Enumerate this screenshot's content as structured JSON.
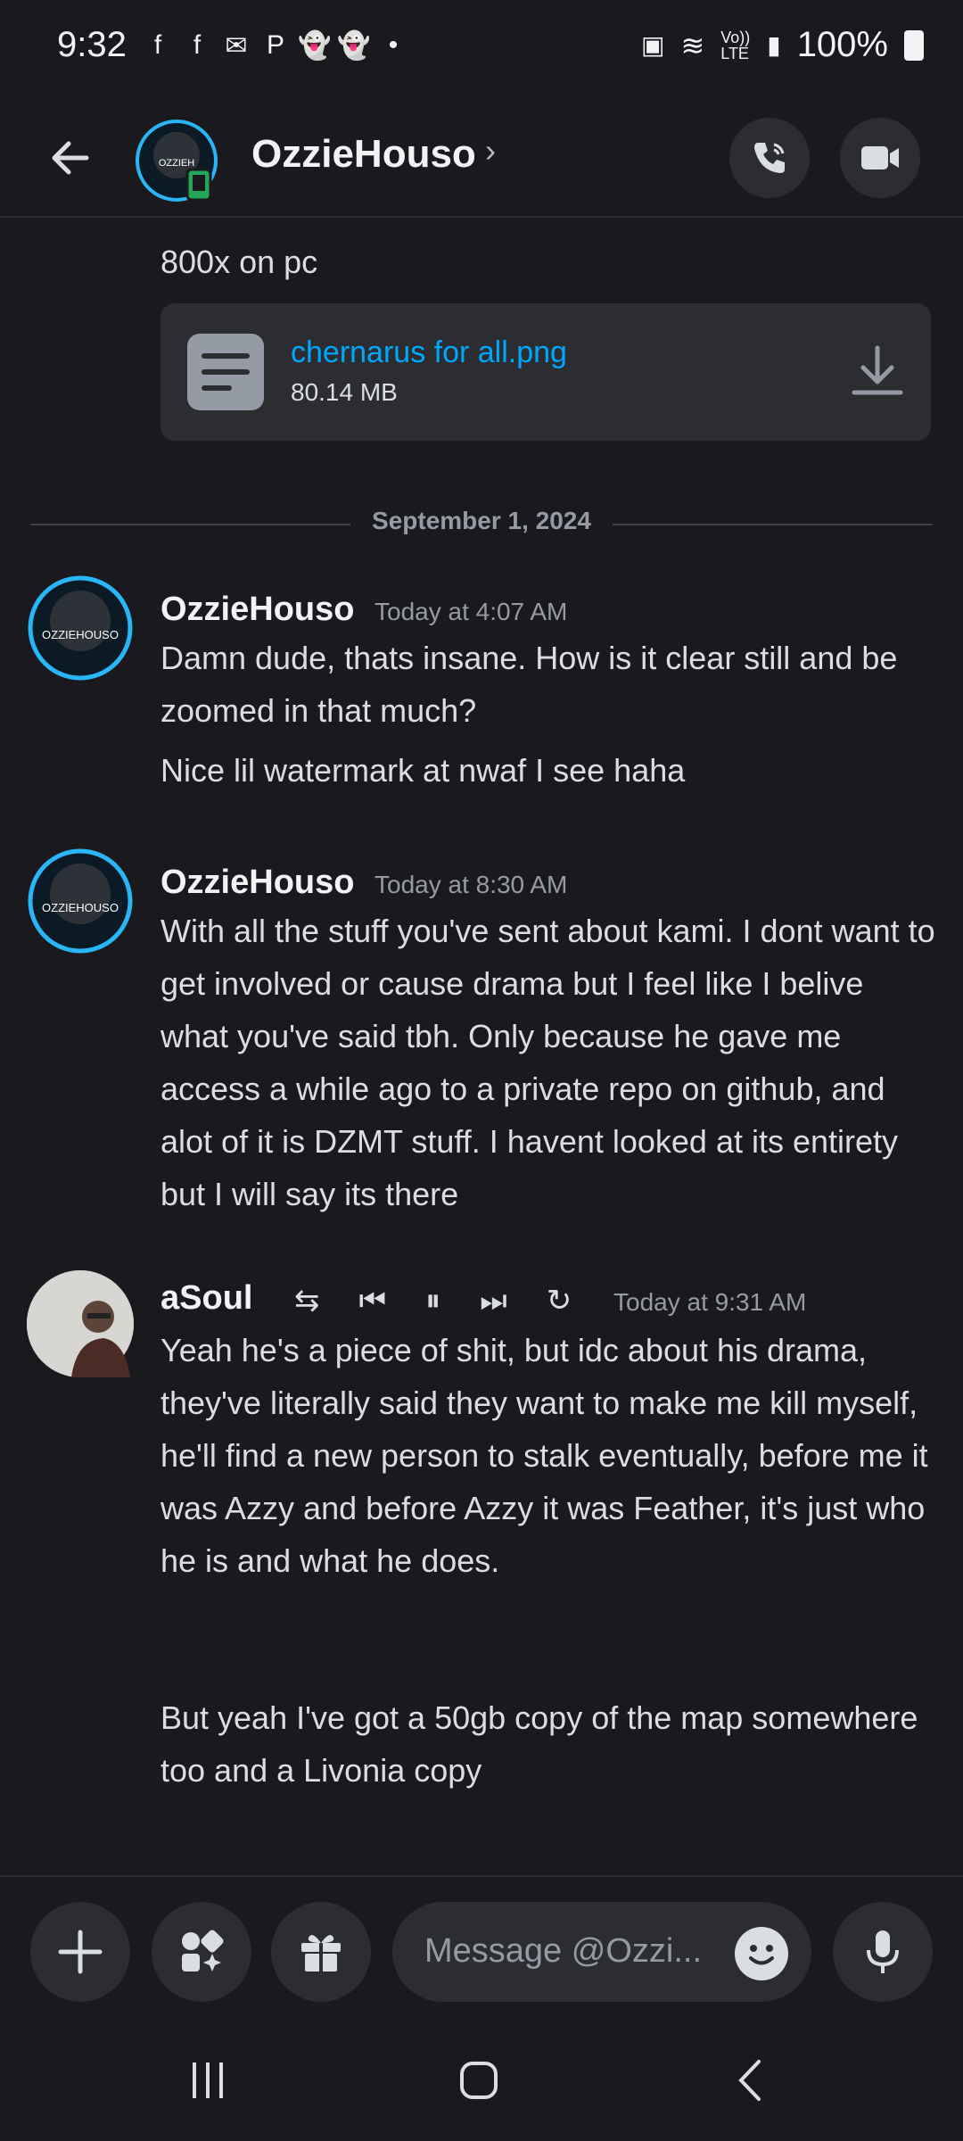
{
  "status_bar": {
    "time": "9:32",
    "battery": "100%",
    "network": "Vo)) LTE",
    "notification_icons": [
      "facebook-icon",
      "facebook-icon",
      "outlook-icon",
      "paypal-icon",
      "snapchat-icon",
      "snapchat-icon",
      "dot-icon"
    ]
  },
  "header": {
    "name": "OzzieHouso",
    "chevron": "›",
    "avatar_text": "OZZIEH"
  },
  "chat": {
    "partial_text": "800x on pc",
    "attachment": {
      "name": "chernarus for all.png",
      "size": "80.14 MB"
    },
    "date_divider": "September 1, 2024",
    "messages": [
      {
        "author": "OzzieHouso",
        "time": "Today at 4:07 AM",
        "avatar_text": "OZZIEHOUSO",
        "lines": [
          "Damn dude, thats insane. How is it clear still and be zoomed in that much?",
          "Nice lil watermark at nwaf I see haha"
        ]
      },
      {
        "author": "OzzieHouso",
        "time": "Today at 8:30 AM",
        "avatar_text": "OZZIEHOUSO",
        "lines": [
          "With all the stuff you've sent about kami. I dont want to get involved or cause drama but I feel like I belive what you've said tbh. Only because he gave me access a while ago to a private repo on github, and alot of it is DZMT stuff. I havent looked at its entirety but I will say its there"
        ]
      },
      {
        "author": "aSoul",
        "time": "Today at 9:31 AM",
        "status_controls": [
          "⇆",
          "⏮",
          "⏸",
          "⏭",
          "↻"
        ],
        "lines": [
          "Yeah he's a piece of shit, but idc about his drama, they've literally said they want to make me kill myself, he'll find a new person to stalk eventually, before me it was Azzy and before Azzy it was Feather, it's just who he is and what he does.",
          "But yeah I've got a 50gb copy of the map somewhere too and a Livonia copy"
        ]
      }
    ]
  },
  "composer": {
    "placeholder": "Message @Ozzi..."
  },
  "colors": {
    "background": "#1a1a1e",
    "surface": "#2b2d31",
    "link": "#00a8fc",
    "text": "#dbdee1",
    "muted": "#949ba4",
    "call_icon_accent": "#23a55a"
  }
}
